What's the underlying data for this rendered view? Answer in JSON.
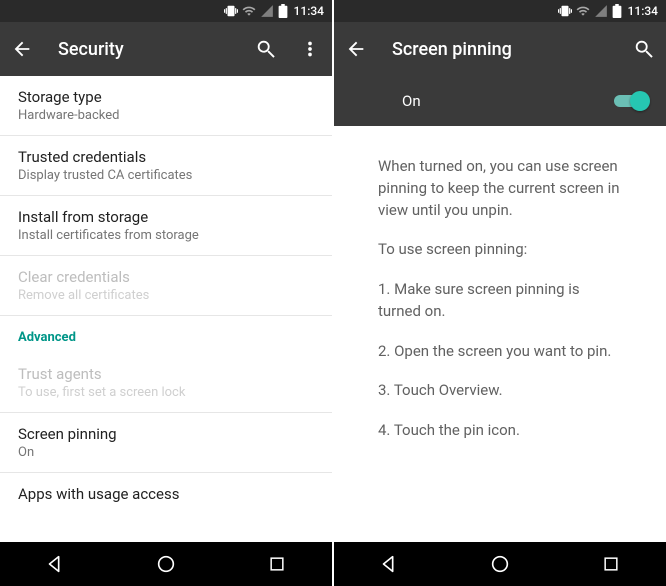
{
  "status": {
    "time": "11:34"
  },
  "left": {
    "title": "Security",
    "items": [
      {
        "primary": "Storage type",
        "secondary": "Hardware-backed",
        "disabled": false
      },
      {
        "primary": "Trusted credentials",
        "secondary": "Display trusted CA certificates",
        "disabled": false
      },
      {
        "primary": "Install from storage",
        "secondary": "Install certificates from storage",
        "disabled": false
      },
      {
        "primary": "Clear credentials",
        "secondary": "Remove all certificates",
        "disabled": true
      }
    ],
    "section": "Advanced",
    "items2": [
      {
        "primary": "Trust agents",
        "secondary": "To use, first set a screen lock",
        "disabled": true
      },
      {
        "primary": "Screen pinning",
        "secondary": "On",
        "disabled": false
      },
      {
        "primary": "Apps with usage access",
        "secondary": "",
        "disabled": false
      }
    ]
  },
  "right": {
    "title": "Screen pinning",
    "toggle": {
      "label": "On",
      "state": "on"
    },
    "desc": {
      "p1": "When turned on, you can use screen pinning to keep the current screen in view until you unpin.",
      "p2": "To use screen pinning:",
      "p3": "1. Make sure screen pinning is turned on.",
      "p4": "2. Open the screen you want to pin.",
      "p5": "3. Touch Overview.",
      "p6": "4. Touch the pin icon."
    }
  }
}
